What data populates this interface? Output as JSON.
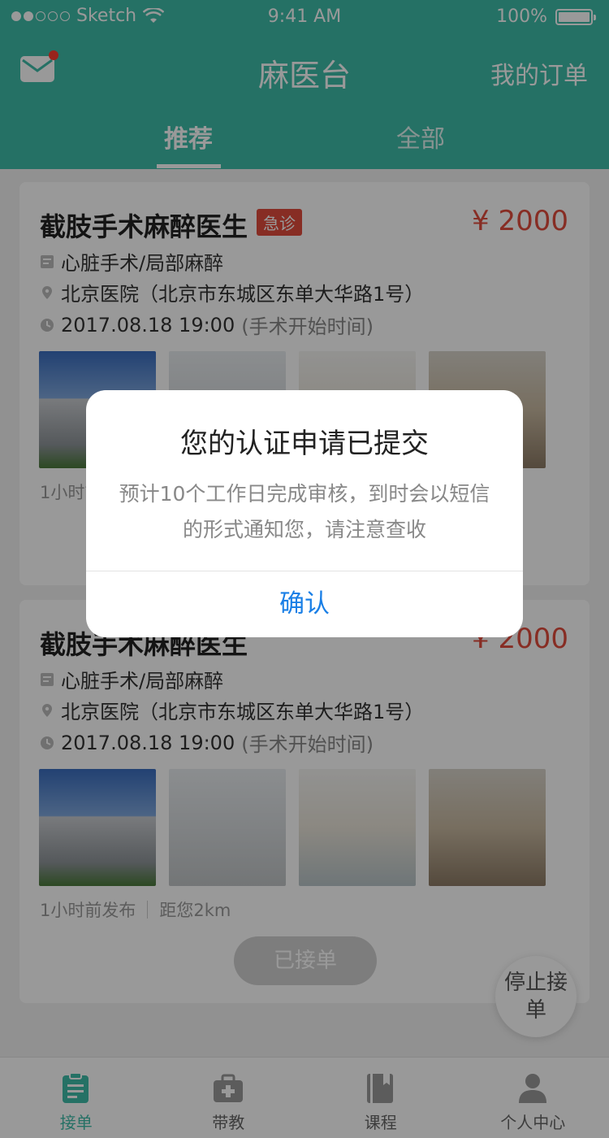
{
  "status_bar": {
    "carrier": "Sketch",
    "time": "9:41 AM",
    "battery": "100%"
  },
  "header": {
    "title": "麻医台",
    "my_orders": "我的订单",
    "tabs": [
      {
        "label": "推荐",
        "active": true
      },
      {
        "label": "全部",
        "active": false
      }
    ]
  },
  "cards": [
    {
      "title": "截肢手术麻醉医生",
      "badge": "急诊",
      "price": "¥ 2000",
      "surgery": "心脏手术/局部麻醉",
      "hospital": "北京医院（北京市东城区东单大华路1号）",
      "time": "2017.08.18 19:00",
      "time_note": "(手术开始时间)",
      "posted": "1小时前发布"
    },
    {
      "title": "截肢手术麻醉医生",
      "price": "¥ 2000",
      "surgery": "心脏手术/局部麻醉",
      "hospital": "北京医院（北京市东城区东单大华路1号）",
      "time": "2017.08.18 19:00",
      "time_note": "(手术开始时间)",
      "posted": "1小时前发布",
      "distance": "距您2km",
      "button": "已接单"
    }
  ],
  "floating": {
    "stop_label": "停止接单"
  },
  "tabbar": {
    "items": [
      {
        "label": "接单",
        "icon": "clipboard-icon",
        "active": true
      },
      {
        "label": "带教",
        "icon": "medkit-icon",
        "active": false
      },
      {
        "label": "课程",
        "icon": "book-icon",
        "active": false
      },
      {
        "label": "个人中心",
        "icon": "person-icon",
        "active": false
      }
    ]
  },
  "modal": {
    "title": "您的认证申请已提交",
    "body": "预计10个工作日完成审核，到时会以短信的形式通知您，请注意查收",
    "confirm": "确认"
  },
  "colors": {
    "primary": "#3fbca9",
    "price": "#e24c3c",
    "link": "#1a7fe6"
  }
}
